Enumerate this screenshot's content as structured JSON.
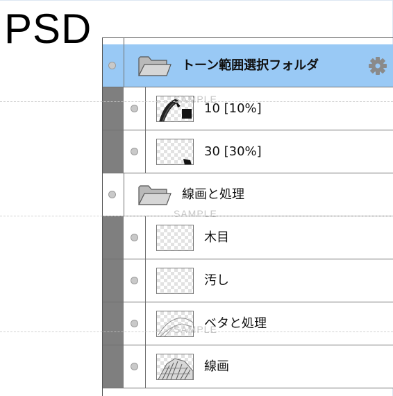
{
  "heading": {
    "text": "PSD"
  },
  "layers": [
    {
      "kind": "folder",
      "label": "トーン範囲選択フォルダ",
      "selected": true,
      "icon": "folder-open-icon",
      "settings_icon": "gear-icon"
    },
    {
      "kind": "layer",
      "label": "10 [10%]",
      "thumb": "tone-10"
    },
    {
      "kind": "layer",
      "label": "30 [30%]",
      "thumb": "tone-30"
    },
    {
      "kind": "folder",
      "label": "線画と処理",
      "selected": false,
      "icon": "folder-open-icon"
    },
    {
      "kind": "layer",
      "label": "木目",
      "thumb": "transparent"
    },
    {
      "kind": "layer",
      "label": "汚し",
      "thumb": "transparent"
    },
    {
      "kind": "layer",
      "label": "ベタと処理",
      "thumb": "line-sketch"
    },
    {
      "kind": "layer",
      "label": "線画",
      "thumb": "line-art"
    }
  ],
  "watermark": {
    "text": "SAMPLE"
  },
  "colors": {
    "selected_row": "#99c9f5",
    "indent_bar": "#7f7f7f",
    "border": "#707070"
  }
}
